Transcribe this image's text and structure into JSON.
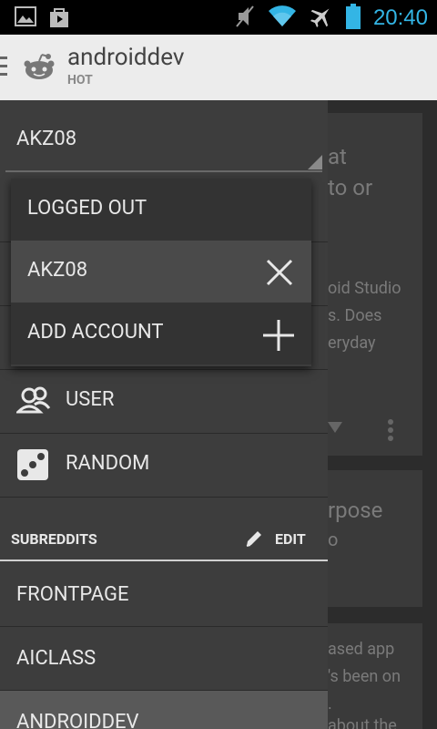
{
  "status_bar": {
    "time": "20:40",
    "icons": [
      "image-icon",
      "bag-icon",
      "mute-icon",
      "wifi-icon",
      "airplane-icon",
      "battery-icon"
    ]
  },
  "action_bar": {
    "title": "androiddev",
    "subtitle": "HOT"
  },
  "drawer": {
    "account_selected": "AKZ08",
    "account_menu": [
      {
        "label": "LOGGED OUT"
      },
      {
        "label": "AKZ08",
        "action_icon": "close-icon"
      },
      {
        "label": "ADD ACCOUNT",
        "action_icon": "plus-icon"
      }
    ],
    "nav_items": [
      {
        "label": "USER",
        "icon": "users-icon"
      },
      {
        "label": "RANDOM",
        "icon": "dice-icon"
      }
    ],
    "section": {
      "label": "SUBREDDITS",
      "edit_label": "EDIT"
    },
    "subreddits": [
      {
        "label": "FRONTPAGE"
      },
      {
        "label": "AICLASS"
      },
      {
        "label": "ANDROIDDEV"
      }
    ]
  },
  "background": {
    "card1_lines": [
      "at",
      "to or"
    ],
    "card2_lines": [
      "oid Studio",
      "s. Does",
      "eryday"
    ],
    "card3_lines": [
      "rpose",
      "o"
    ],
    "card4_lines": [
      "ased app",
      "'s been on",
      ".",
      "about the"
    ]
  },
  "colors": {
    "accent": "#33b5e5",
    "drawer_bg": "#3d3d3d",
    "popup_bg": "#333333",
    "popup_selected_bg": "#4a4a4a",
    "action_bar_bg": "#ececec"
  }
}
